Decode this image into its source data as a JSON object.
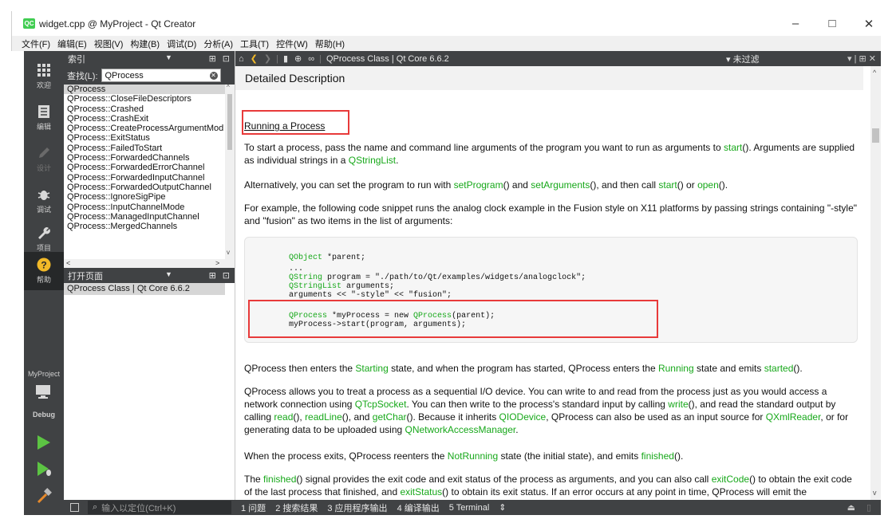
{
  "window": {
    "title": "widget.cpp @ MyProject - Qt Creator",
    "logo_text": "QC",
    "controls": [
      "–",
      "□",
      "✕"
    ]
  },
  "menubar": {
    "items": [
      "文件(F)",
      "编辑(E)",
      "视图(V)",
      "构建(B)",
      "调试(D)",
      "分析(A)",
      "工具(T)",
      "控件(W)",
      "帮助(H)"
    ]
  },
  "modes": [
    {
      "label": "欢迎",
      "icon": "grid-icon"
    },
    {
      "label": "编辑",
      "icon": "document-icon"
    },
    {
      "label": "设计",
      "icon": "pencil-icon"
    },
    {
      "label": "调试",
      "icon": "bug-icon"
    },
    {
      "label": "项目",
      "icon": "wrench-icon"
    },
    {
      "label": "帮助",
      "icon": "help-icon"
    }
  ],
  "project": {
    "name": "MyProject",
    "build": "Debug"
  },
  "sidebar": {
    "index_label": "索引",
    "filter_label": "查找(L):",
    "filter_value": "QProcess",
    "index_items": [
      "QProcess",
      "QProcess::CloseFileDescriptors",
      "QProcess::Crashed",
      "QProcess::CrashExit",
      "QProcess::CreateProcessArgumentMod",
      "QProcess::ExitStatus",
      "QProcess::FailedToStart",
      "QProcess::ForwardedChannels",
      "QProcess::ForwardedErrorChannel",
      "QProcess::ForwardedInputChannel",
      "QProcess::ForwardedOutputChannel",
      "QProcess::IgnoreSigPipe",
      "QProcess::InputChannelMode",
      "QProcess::ManagedInputChannel",
      "QProcess::MergedChannels"
    ],
    "open_pages_label": "打开页面",
    "open_pages": [
      "QProcess Class | Qt Core 6.6.2"
    ]
  },
  "doc_toolbar": {
    "page_title": "QProcess Class | Qt Core 6.6.2",
    "filter": "未过滤"
  },
  "doc": {
    "header": "Detailed Description",
    "section_title": "Running a Process",
    "p1": {
      "t1": "To start a process, pass the name and command line arguments of the program you want to run as arguments to ",
      "link1": "start",
      "t2": "(). Arguments are supplied as individual strings in a ",
      "link2": "QStringList",
      "t3": "."
    },
    "p2": {
      "t1": "Alternatively, you can set the program to run with ",
      "link1": "setProgram",
      "t2": "() and ",
      "link2": "setArguments",
      "t3": "(), and then call ",
      "link3": "start",
      "t4": "() or ",
      "link4": "open",
      "t5": "()."
    },
    "p3": "For example, the following code snippet runs the analog clock example in the Fusion style on X11 platforms by passing strings containing \"-style\" and \"fusion\" as two items in the list of arguments:",
    "code": {
      "l1a": "QObject",
      "l1b": " *parent;",
      "l2": "...",
      "l3a": "QString",
      "l3b": " program = \"./path/to/Qt/examples/widgets/analogclock\";",
      "l4a": "QStringList",
      "l4b": " arguments;",
      "l5": "arguments << \"-style\" << \"fusion\";",
      "l6a": "QProcess",
      "l6b": " *myProcess = new ",
      "l6c": "QProcess",
      "l6d": "(parent);",
      "l7": "myProcess->start(program, arguments);"
    },
    "p4": {
      "t1": "QProcess then enters the ",
      "link1": "Starting",
      "t2": " state, and when the program has started, QProcess enters the ",
      "link2": "Running",
      "t3": " state and emits ",
      "link3": "started",
      "t4": "()."
    },
    "p5": {
      "t1": "QProcess allows you to treat a process as a sequential I/O device. You can write to and read from the process just as you would access a network connection using ",
      "link1": "QTcpSocket",
      "t2": ". You can then write to the process's standard input by calling ",
      "link2": "write",
      "t3": "(), and read the standard output by calling ",
      "link3": "read",
      "t4": "(), ",
      "link4": "readLine",
      "t5": "(), and ",
      "link5": "getChar",
      "t6": "(). Because it inherits ",
      "link6": "QIODevice",
      "t7": ", QProcess can also be used as an input source for ",
      "link7": "QXmlReader",
      "t8": ", or for generating data to be uploaded using ",
      "link8": "QNetworkAccessManager",
      "t9": "."
    },
    "p6": {
      "t1": "When the process exits, QProcess reenters the ",
      "link1": "NotRunning",
      "t2": " state (the initial state), and emits ",
      "link2": "finished",
      "t3": "()."
    },
    "p7": {
      "t1": "The ",
      "link1": "finished",
      "t2": "() signal provides the exit code and exit status of the process as arguments, and you can also call ",
      "link2": "exitCode",
      "t3": "() to obtain the exit code of the last process that finished, and ",
      "link3": "exitStatus",
      "t4": "() to obtain its exit status. If an error occurs at any point in time, QProcess will emit the"
    }
  },
  "statusbar": {
    "locator_placeholder": "输入以定位(Ctrl+K)",
    "tabs": [
      "1 问题",
      "2 搜索结果",
      "3 应用程序输出",
      "4 编译输出",
      "5 Terminal",
      "⇕"
    ]
  },
  "colors": {
    "link": "#17a81a",
    "highlight_box": "#e83a3a",
    "dark_panel": "#404244"
  }
}
